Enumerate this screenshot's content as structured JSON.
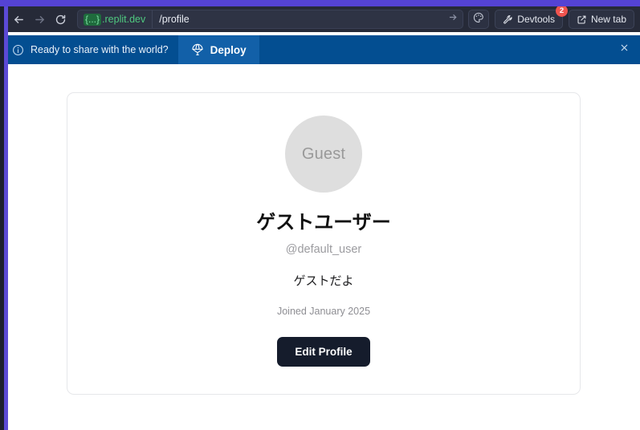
{
  "browser": {
    "nav": {
      "back_icon": "arrow-left-icon",
      "forward_icon": "arrow-right-icon",
      "reload_icon": "reload-icon"
    },
    "url": {
      "host_badge": "{...}",
      "host_suffix": ".replit.dev",
      "path": "/profile",
      "go_icon": "arrow-right-icon"
    },
    "actions": {
      "palette_icon": "palette-icon",
      "devtools_label": "Devtools",
      "devtools_icon": "wrench-icon",
      "devtools_badge": "2",
      "new_tab_label": "New tab",
      "new_tab_icon": "external-link-icon"
    }
  },
  "banner": {
    "info_icon": "info-icon",
    "message": "Ready to share with the world?",
    "deploy_label": "Deploy",
    "deploy_icon": "deploy-icon",
    "close_icon": "close-icon"
  },
  "profile": {
    "avatar_initials": "Guest",
    "display_name": "ゲストユーザー",
    "handle": "@default_user",
    "bio": "ゲストだよ",
    "joined": "Joined January 2025",
    "edit_button_label": "Edit Profile"
  },
  "colors": {
    "accent_purple": "#5443d4",
    "banner_blue": "#034e91",
    "deploy_blue": "#1260a8",
    "badge_red": "#f0544f",
    "chrome_dark": "#262a38",
    "button_dark": "#151c2c",
    "url_green": "#4fc97f"
  }
}
